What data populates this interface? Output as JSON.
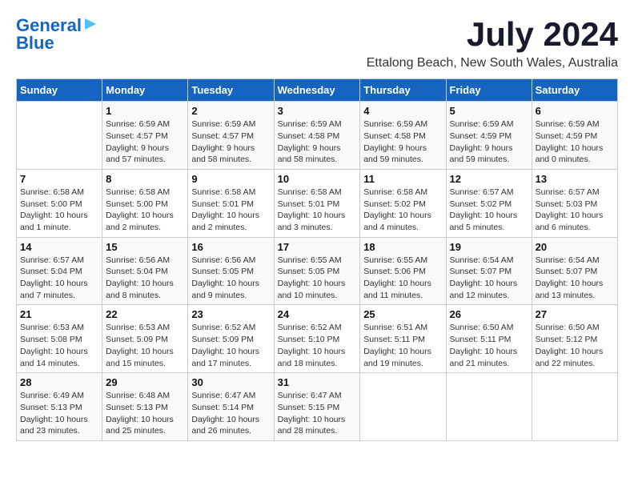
{
  "header": {
    "logo_line1": "General",
    "logo_line2": "Blue",
    "title": "July 2024",
    "subtitle": "Ettalong Beach, New South Wales, Australia"
  },
  "calendar": {
    "days_of_week": [
      "Sunday",
      "Monday",
      "Tuesday",
      "Wednesday",
      "Thursday",
      "Friday",
      "Saturday"
    ],
    "weeks": [
      [
        {
          "day": "",
          "info": ""
        },
        {
          "day": "1",
          "info": "Sunrise: 6:59 AM\nSunset: 4:57 PM\nDaylight: 9 hours\nand 57 minutes."
        },
        {
          "day": "2",
          "info": "Sunrise: 6:59 AM\nSunset: 4:57 PM\nDaylight: 9 hours\nand 58 minutes."
        },
        {
          "day": "3",
          "info": "Sunrise: 6:59 AM\nSunset: 4:58 PM\nDaylight: 9 hours\nand 58 minutes."
        },
        {
          "day": "4",
          "info": "Sunrise: 6:59 AM\nSunset: 4:58 PM\nDaylight: 9 hours\nand 59 minutes."
        },
        {
          "day": "5",
          "info": "Sunrise: 6:59 AM\nSunset: 4:59 PM\nDaylight: 9 hours\nand 59 minutes."
        },
        {
          "day": "6",
          "info": "Sunrise: 6:59 AM\nSunset: 4:59 PM\nDaylight: 10 hours\nand 0 minutes."
        }
      ],
      [
        {
          "day": "7",
          "info": "Sunrise: 6:58 AM\nSunset: 5:00 PM\nDaylight: 10 hours\nand 1 minute."
        },
        {
          "day": "8",
          "info": "Sunrise: 6:58 AM\nSunset: 5:00 PM\nDaylight: 10 hours\nand 2 minutes."
        },
        {
          "day": "9",
          "info": "Sunrise: 6:58 AM\nSunset: 5:01 PM\nDaylight: 10 hours\nand 2 minutes."
        },
        {
          "day": "10",
          "info": "Sunrise: 6:58 AM\nSunset: 5:01 PM\nDaylight: 10 hours\nand 3 minutes."
        },
        {
          "day": "11",
          "info": "Sunrise: 6:58 AM\nSunset: 5:02 PM\nDaylight: 10 hours\nand 4 minutes."
        },
        {
          "day": "12",
          "info": "Sunrise: 6:57 AM\nSunset: 5:02 PM\nDaylight: 10 hours\nand 5 minutes."
        },
        {
          "day": "13",
          "info": "Sunrise: 6:57 AM\nSunset: 5:03 PM\nDaylight: 10 hours\nand 6 minutes."
        }
      ],
      [
        {
          "day": "14",
          "info": "Sunrise: 6:57 AM\nSunset: 5:04 PM\nDaylight: 10 hours\nand 7 minutes."
        },
        {
          "day": "15",
          "info": "Sunrise: 6:56 AM\nSunset: 5:04 PM\nDaylight: 10 hours\nand 8 minutes."
        },
        {
          "day": "16",
          "info": "Sunrise: 6:56 AM\nSunset: 5:05 PM\nDaylight: 10 hours\nand 9 minutes."
        },
        {
          "day": "17",
          "info": "Sunrise: 6:55 AM\nSunset: 5:05 PM\nDaylight: 10 hours\nand 10 minutes."
        },
        {
          "day": "18",
          "info": "Sunrise: 6:55 AM\nSunset: 5:06 PM\nDaylight: 10 hours\nand 11 minutes."
        },
        {
          "day": "19",
          "info": "Sunrise: 6:54 AM\nSunset: 5:07 PM\nDaylight: 10 hours\nand 12 minutes."
        },
        {
          "day": "20",
          "info": "Sunrise: 6:54 AM\nSunset: 5:07 PM\nDaylight: 10 hours\nand 13 minutes."
        }
      ],
      [
        {
          "day": "21",
          "info": "Sunrise: 6:53 AM\nSunset: 5:08 PM\nDaylight: 10 hours\nand 14 minutes."
        },
        {
          "day": "22",
          "info": "Sunrise: 6:53 AM\nSunset: 5:09 PM\nDaylight: 10 hours\nand 15 minutes."
        },
        {
          "day": "23",
          "info": "Sunrise: 6:52 AM\nSunset: 5:09 PM\nDaylight: 10 hours\nand 17 minutes."
        },
        {
          "day": "24",
          "info": "Sunrise: 6:52 AM\nSunset: 5:10 PM\nDaylight: 10 hours\nand 18 minutes."
        },
        {
          "day": "25",
          "info": "Sunrise: 6:51 AM\nSunset: 5:11 PM\nDaylight: 10 hours\nand 19 minutes."
        },
        {
          "day": "26",
          "info": "Sunrise: 6:50 AM\nSunset: 5:11 PM\nDaylight: 10 hours\nand 21 minutes."
        },
        {
          "day": "27",
          "info": "Sunrise: 6:50 AM\nSunset: 5:12 PM\nDaylight: 10 hours\nand 22 minutes."
        }
      ],
      [
        {
          "day": "28",
          "info": "Sunrise: 6:49 AM\nSunset: 5:13 PM\nDaylight: 10 hours\nand 23 minutes."
        },
        {
          "day": "29",
          "info": "Sunrise: 6:48 AM\nSunset: 5:13 PM\nDaylight: 10 hours\nand 25 minutes."
        },
        {
          "day": "30",
          "info": "Sunrise: 6:47 AM\nSunset: 5:14 PM\nDaylight: 10 hours\nand 26 minutes."
        },
        {
          "day": "31",
          "info": "Sunrise: 6:47 AM\nSunset: 5:15 PM\nDaylight: 10 hours\nand 28 minutes."
        },
        {
          "day": "",
          "info": ""
        },
        {
          "day": "",
          "info": ""
        },
        {
          "day": "",
          "info": ""
        }
      ]
    ]
  }
}
